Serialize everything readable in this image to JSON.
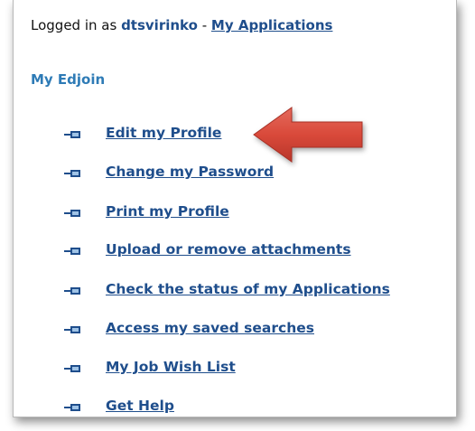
{
  "header": {
    "logged_in_prefix": "Logged in as",
    "username": "dtsvirinko",
    "separator": "-",
    "my_applications_link": "My Applications"
  },
  "section": {
    "title": "My Edjoin"
  },
  "menu": {
    "items": [
      {
        "label": "Edit my Profile",
        "icon": "bullet-pin-icon"
      },
      {
        "label": "Change my Password",
        "icon": "bullet-pin-icon"
      },
      {
        "label": "Print my Profile",
        "icon": "bullet-pin-icon"
      },
      {
        "label": "Upload or remove attachments",
        "icon": "bullet-pin-icon"
      },
      {
        "label": "Check the status of my Applications",
        "icon": "bullet-pin-icon"
      },
      {
        "label": "Access my saved searches",
        "icon": "bullet-pin-icon"
      },
      {
        "label": "My Job Wish List",
        "icon": "bullet-pin-icon"
      },
      {
        "label": "Get Help",
        "icon": "bullet-pin-icon"
      }
    ]
  },
  "annotation": {
    "icon": "red-arrow-icon",
    "color": "#d9493a"
  },
  "colors": {
    "link": "#1f4e8c",
    "section_title": "#2e7bb6",
    "text": "#111111",
    "bullet": "#1f4e8c"
  }
}
